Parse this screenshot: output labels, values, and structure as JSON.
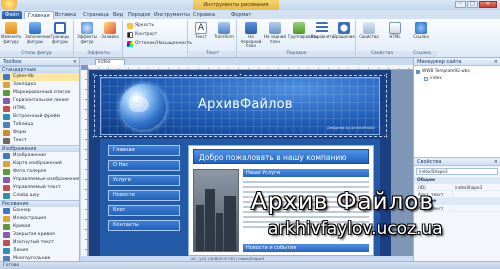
{
  "titlebar": {
    "context_label": "Инструменты рисования",
    "minimize": "–",
    "maximize": "□",
    "close": "✕"
  },
  "tabs": [
    {
      "label": "Файл"
    },
    {
      "label": "Главная"
    },
    {
      "label": "Вставка"
    },
    {
      "label": "Страница"
    },
    {
      "label": "Вид"
    },
    {
      "label": "Порядок"
    },
    {
      "label": "Инструменты"
    },
    {
      "label": "Справка"
    },
    {
      "label": "Формат"
    }
  ],
  "ribbon": {
    "g1": {
      "b1": "Изменить фигуру",
      "b2": "Заполнение фигуры",
      "b3": "Границы фигуры",
      "label": "Стиль фигур"
    },
    "g2": {
      "b1": "Эффекты фигур",
      "b2": "Заливка",
      "label": "Эффекты"
    },
    "g3": {
      "s1": "Яркость",
      "s2": "Контраст",
      "s3": "Оттенок/Насыщенность"
    },
    "g4": {
      "b1": "Текст",
      "b2": "Transform",
      "label": "Текст"
    },
    "g5": {
      "b1": "На передний план",
      "b2": "На задний план",
      "b3": "Группировать",
      "b4": "Выровнять",
      "b5": "Вращение",
      "label": "Порядок"
    },
    "g6": {
      "b1": "Свойства",
      "b2": "HTML",
      "b3": "Ссылка",
      "label": "Свойства",
      "label2": "Ссылка"
    }
  },
  "toolbox": {
    "title": "Toolbox",
    "cat1": "Стандартные",
    "items1": [
      "Cyber-Ab",
      "Закладка",
      "Маркированный список",
      "Горизонтальная линия",
      "HTML",
      "Встроенный фрейм",
      "Таблица",
      "Форм",
      "Текст"
    ],
    "cat2": "Изображения",
    "items2": [
      "Изображение",
      "Карта изображений",
      "Фото галерея",
      "Управляемые изображения",
      "Управляемый текст",
      "Слайд шоу"
    ],
    "cat3": "Рисование",
    "items3": [
      "Баннер",
      "Иллюстрация",
      "Кривая",
      "Закрытая кривая",
      "Изогнутый текст",
      "Линия",
      "Многоугольник",
      "Ломаная"
    ]
  },
  "document": {
    "tab": "index",
    "status": "x0 , y10  |  W:800 H:130  |  index/Shape3"
  },
  "site": {
    "brand": "АрхивФайлов",
    "credit": "Designed by ArchiveFailov",
    "menu": [
      "Главная",
      "О Нас",
      "Услуги",
      "Новости",
      "Блог",
      "Контакты"
    ],
    "welcome": "Добро пожаловать в нашу компанию",
    "section1": "Наши Услуги",
    "section2": "Новости и события"
  },
  "site_manager": {
    "title": "Менеджер сайта",
    "tree": [
      "WWB Template92.wbs",
      "index"
    ]
  },
  "properties": {
    "title": "Свойства",
    "selected": "index/Shape3",
    "head1": "Общее",
    "rows1": [
      {
        "k": "(ID)",
        "v": "indexShape3"
      },
      {
        "k": "Альт. текст",
        "v": ""
      }
    ],
    "head2": "Прочее",
    "rows2": [
      {
        "k": "Альт. текст",
        "v": ""
      }
    ]
  },
  "statusbottom": {
    "text": "Готово"
  },
  "watermark": {
    "line1": "Архив Файлов",
    "line2": "arkhivfaylov.ucoz.ua"
  },
  "colors": {
    "ribbon_accent": "#2b5aa5",
    "site_blue": "#1c3f82",
    "header_blue": "#1f5bb5",
    "selected_item": "#fbe6a2"
  }
}
